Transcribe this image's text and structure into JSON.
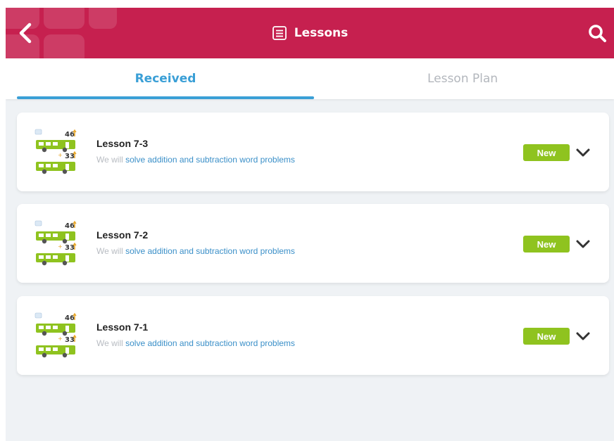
{
  "header": {
    "title": "Lessons",
    "accent_color": "#c6204f",
    "icons": {
      "back": "chevron-left-icon",
      "title": "lesson-list-icon",
      "search": "search-icon"
    }
  },
  "tabs": [
    {
      "label": "Received",
      "active": true
    },
    {
      "label": "Lesson Plan",
      "active": false
    }
  ],
  "lessons": [
    {
      "title": "Lesson 7-3",
      "desc_prefix": "We will ",
      "desc_highlight": "solve addition and subtraction word problems",
      "badge": "New",
      "thumb_top": "46",
      "thumb_bottom": "33"
    },
    {
      "title": "Lesson 7-2",
      "desc_prefix": "We will ",
      "desc_highlight": "solve addition and subtraction word problems",
      "badge": "New",
      "thumb_top": "46",
      "thumb_bottom": "33"
    },
    {
      "title": "Lesson 7-1",
      "desc_prefix": "We will ",
      "desc_highlight": "solve addition and subtraction word problems",
      "badge": "New",
      "thumb_top": "46",
      "thumb_bottom": "33"
    }
  ],
  "colors": {
    "tab_active": "#3a9fd6",
    "badge": "#8fc31f",
    "highlight": "#3a8fc8"
  }
}
